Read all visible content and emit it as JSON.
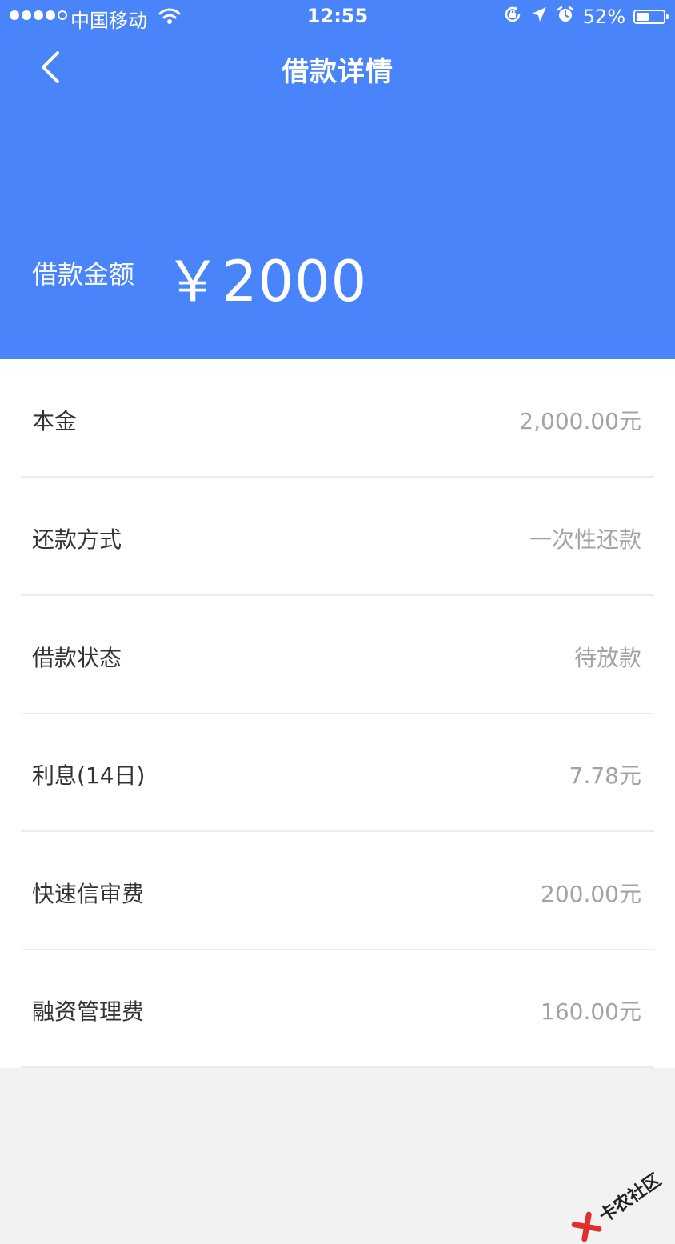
{
  "status_bar": {
    "carrier": "中国移动",
    "time": "12:55",
    "battery": "52%",
    "battery_level": 0.52
  },
  "nav": {
    "title": "借款详情"
  },
  "summary": {
    "amount_label": "借款金额",
    "amount_value": "￥2000"
  },
  "details": [
    {
      "label": "本金",
      "value": "2,000.00元"
    },
    {
      "label": "还款方式",
      "value": "一次性还款"
    },
    {
      "label": "借款状态",
      "value": "待放款"
    },
    {
      "label": "利息(14日)",
      "value": "7.78元"
    },
    {
      "label": "快速信审费",
      "value": "200.00元"
    },
    {
      "label": "融资管理费",
      "value": "160.00元"
    }
  ],
  "watermark": {
    "text": "卡农社区"
  },
  "colors": {
    "header_bg": "#4a84fb",
    "page_bg": "#f2f2f2",
    "value_text": "#a3a3a3"
  }
}
